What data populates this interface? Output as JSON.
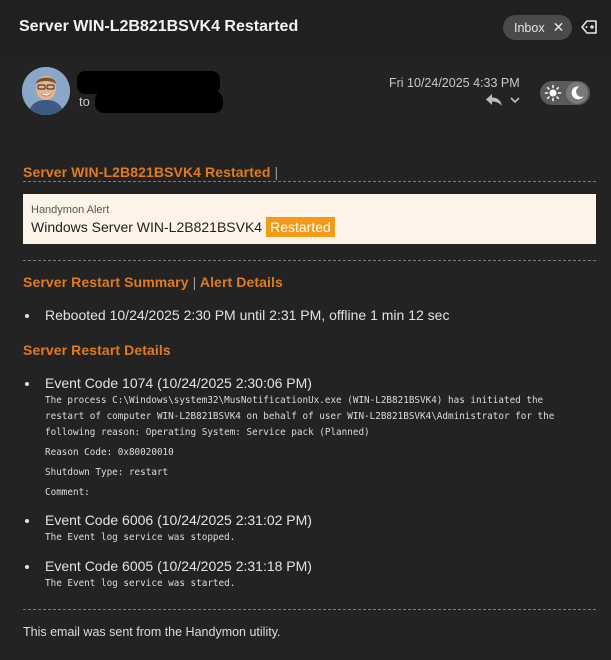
{
  "header": {
    "subject": "Server WIN-L2B821BSVK4 Restarted",
    "inbox_label": "Inbox",
    "inbox_close": "✕"
  },
  "sender": {
    "to_label": "to",
    "date": "Fri 10/24/2025 4:33 PM"
  },
  "email": {
    "title": "Server WIN-L2B821BSVK4 Restarted",
    "title_sep": "|",
    "alert_small": "Handymon Alert",
    "alert_main": "Windows Server WIN-L2B821BSVK4",
    "alert_badge": "Restarted",
    "summary_heading": "Server Restart Summary",
    "summary_sep": "|",
    "alert_details_link": "Alert Details",
    "summary_item": "Rebooted 10/24/2025 2:30 PM until 2:31 PM, offline 1 min 12 sec",
    "details_heading": "Server Restart Details",
    "events": [
      {
        "title": "Event Code 1074 (10/24/2025 2:30:06 PM)",
        "lines": [
          "The process C:\\Windows\\system32\\MusNotificationUx.exe (WIN-L2B821BSVK4) has initiated the",
          "restart of computer WIN-L2B821BSVK4 on behalf of user WIN-L2B821BSVK4\\Administrator for the",
          "following reason: Operating System: Service pack (Planned)"
        ],
        "reason": "Reason Code: 0x80020010",
        "shutdown": "Shutdown Type: restart",
        "comment": "Comment:"
      },
      {
        "title": "Event Code 6006 (10/24/2025 2:31:02 PM)",
        "line": "The Event log service was stopped."
      },
      {
        "title": "Event Code 6005 (10/24/2025 2:31:18 PM)",
        "line": "The Event log service was started."
      }
    ],
    "footer": "This email was sent from the Handymon utility."
  },
  "colors": {
    "accent": "#e07b1f",
    "badge": "#f39a18",
    "alert_bg": "#fdf3e8",
    "background": "#232323"
  }
}
